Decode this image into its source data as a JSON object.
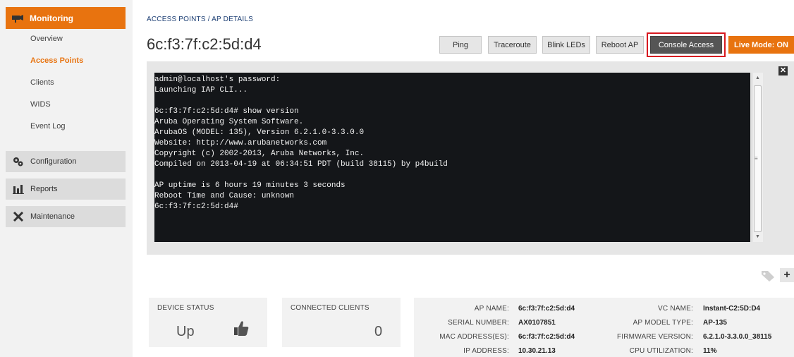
{
  "sidebar": {
    "monitoring_label": "Monitoring",
    "items": [
      "Overview",
      "Access Points",
      "Clients",
      "WIDS",
      "Event Log"
    ],
    "configuration_label": "Configuration",
    "reports_label": "Reports",
    "maintenance_label": "Maintenance"
  },
  "breadcrumb": {
    "root": "ACCESS POINTS",
    "sep": " / ",
    "current": "AP DETAILS"
  },
  "ap_title": "6c:f3:7f:c2:5d:d4",
  "toolbar": {
    "ping": "Ping",
    "traceroute": "Traceroute",
    "blink_leds": "Blink LEDs",
    "reboot_ap": "Reboot AP",
    "console_access": "Console Access",
    "live_mode": "Live Mode: ON"
  },
  "terminal": {
    "lines": "admin@localhost's password:\nLaunching IAP CLI...\n\n6c:f3:7f:c2:5d:d4# show version\nAruba Operating System Software.\nArubaOS (MODEL: 135), Version 6.2.1.0-3.3.0.0\nWebsite: http://www.arubanetworks.com\nCopyright (c) 2002-2013, Aruba Networks, Inc.\nCompiled on 2013-04-19 at 06:34:51 PDT (build 38115) by p4build\n\nAP uptime is 6 hours 19 minutes 3 seconds\nReboot Time and Cause: unknown\n6c:f3:7f:c2:5d:d4#"
  },
  "close_glyph": "✕",
  "plus_glyph": "+",
  "device_status": {
    "label": "DEVICE STATUS",
    "value": "Up"
  },
  "connected_clients": {
    "label": "CONNECTED CLIENTS",
    "value": "0"
  },
  "details": {
    "left": [
      {
        "key": "AP NAME:",
        "value": "6c:f3:7f:c2:5d:d4"
      },
      {
        "key": "SERIAL NUMBER:",
        "value": "AX0107851"
      },
      {
        "key": "MAC ADDRESS(ES):",
        "value": "6c:f3:7f:c2:5d:d4"
      },
      {
        "key": "IP ADDRESS:",
        "value": "10.30.21.13"
      }
    ],
    "right": [
      {
        "key": "VC NAME:",
        "value": "Instant-C2:5D:D4"
      },
      {
        "key": "AP MODEL TYPE:",
        "value": "AP-135"
      },
      {
        "key": "FIRMWARE VERSION:",
        "value": "6.2.1.0-3.3.0.0_38115"
      },
      {
        "key": "CPU UTILIZATION:",
        "value": "11%"
      }
    ]
  },
  "colors": {
    "accent": "#e8730f",
    "highlight": "#d71920",
    "terminal_bg": "#141619"
  },
  "icons": {
    "monitoring": "camera-icon",
    "configuration": "gears-icon",
    "reports": "bar-chart-icon",
    "maintenance": "tools-icon",
    "thumbs_up": "thumbs-up-icon",
    "tag": "tag-icon"
  }
}
